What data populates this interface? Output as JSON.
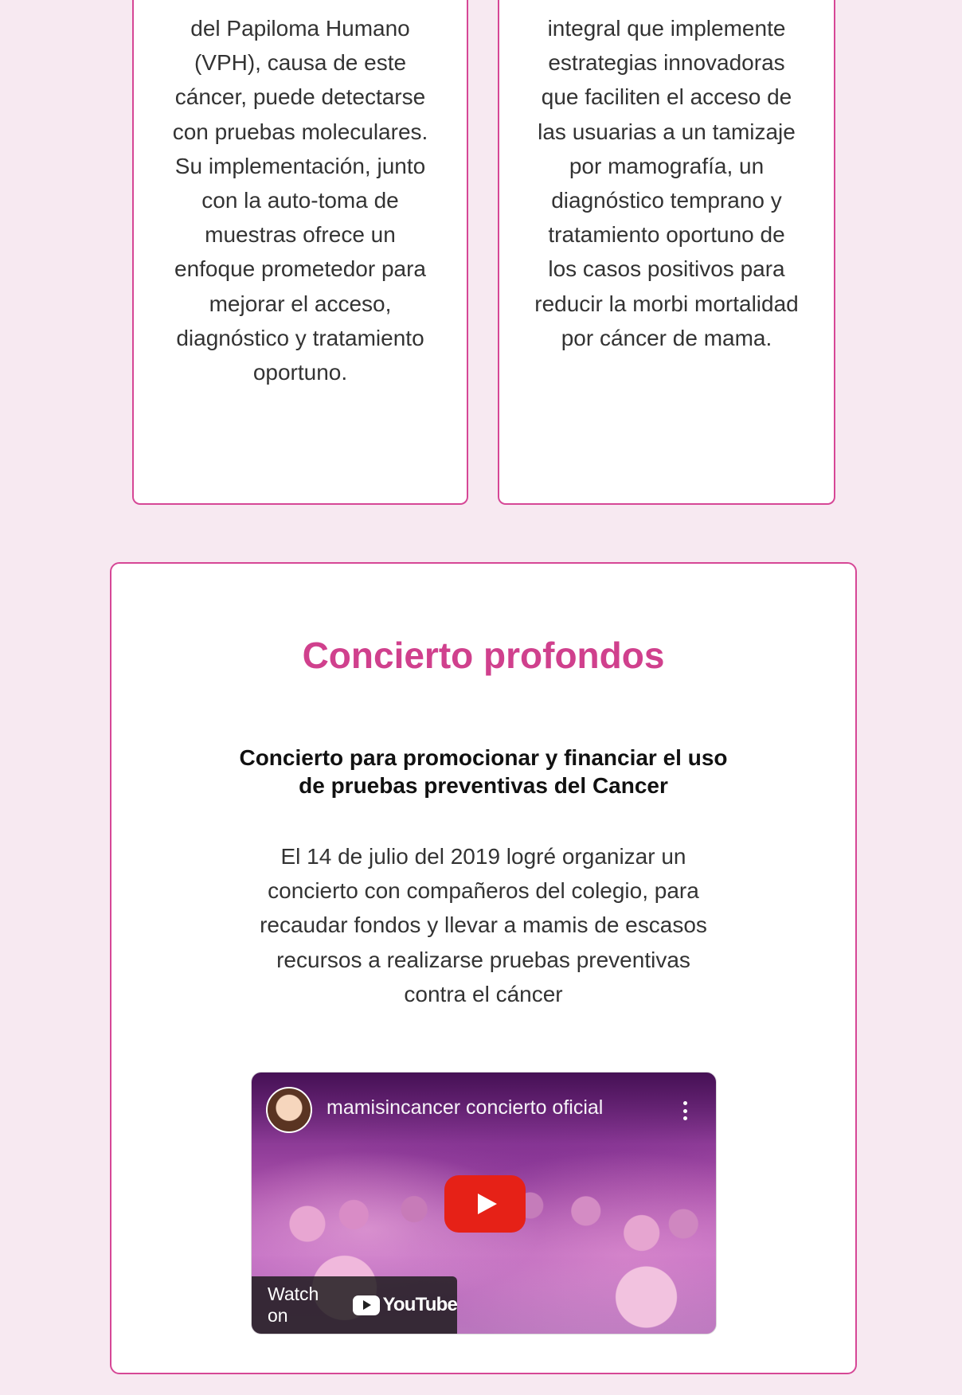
{
  "colors": {
    "page_background": "#f7e9f1",
    "accent": "#d0408d",
    "card_border": "#d64796",
    "youtube_red": "#e62117"
  },
  "cards": {
    "left": {
      "text": "del Papiloma Humano (VPH), causa de este cáncer, puede detectarse con pruebas moleculares. Su implementación, junto con la auto-toma de muestras ofrece un enfoque prometedor para mejorar el acceso, diagnóstico y tratamiento oportuno."
    },
    "right": {
      "text": "integral que implemente estrategias innovadoras que faciliten el acceso de las usuarias a un tamizaje por mamografía, un diagnóstico temprano y tratamiento oportuno de los casos positivos para reducir la morbi mortalidad por cáncer de mama."
    }
  },
  "concert": {
    "title": "Concierto profondos",
    "subtitle": "Concierto para promocionar y financiar el uso de pruebas preventivas del Cancer",
    "body": "El 14 de julio del 2019 logré organizar un concierto con compañeros del colegio, para recaudar fondos y llevar a mamis de escasos recursos a realizarse pruebas preventivas contra el cáncer",
    "video": {
      "title": "mamisincancer concierto oficial",
      "watch_on_label": "Watch on",
      "youtube_label": "YouTube",
      "icons": {
        "more": "more-vertical-icon",
        "play": "play-icon",
        "youtube": "youtube-logo-icon",
        "avatar": "channel-avatar"
      }
    }
  }
}
